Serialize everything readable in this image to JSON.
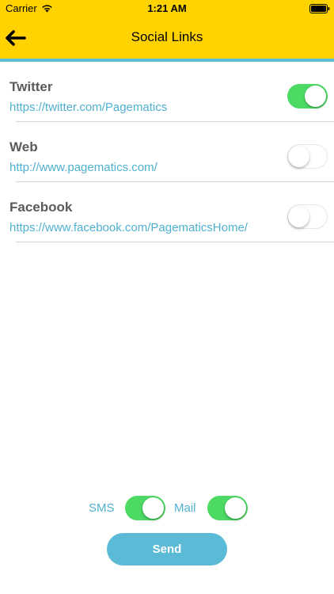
{
  "status_bar": {
    "carrier": "Carrier",
    "time": "1:21 AM",
    "wifi_icon": "wifi-icon",
    "battery_icon": "battery-icon"
  },
  "nav": {
    "back_icon": "back-arrow-icon",
    "title": "Social Links"
  },
  "colors": {
    "brand_yellow": "#ffd200",
    "accent_blue": "#5bbad5",
    "link_blue": "#4fb0d0",
    "toggle_on_green": "#4cd964"
  },
  "social_links": [
    {
      "title": "Twitter",
      "url": "https://twitter.com/Pagematics",
      "enabled": true
    },
    {
      "title": "Web",
      "url": "http://www.pagematics.com/",
      "enabled": false
    },
    {
      "title": "Facebook",
      "url": "https://www.facebook.com/PagematicsHome/",
      "enabled": false
    }
  ],
  "send_options": {
    "sms_label": "SMS",
    "sms_enabled": true,
    "mail_label": "Mail",
    "mail_enabled": true
  },
  "send_button_label": "Send"
}
